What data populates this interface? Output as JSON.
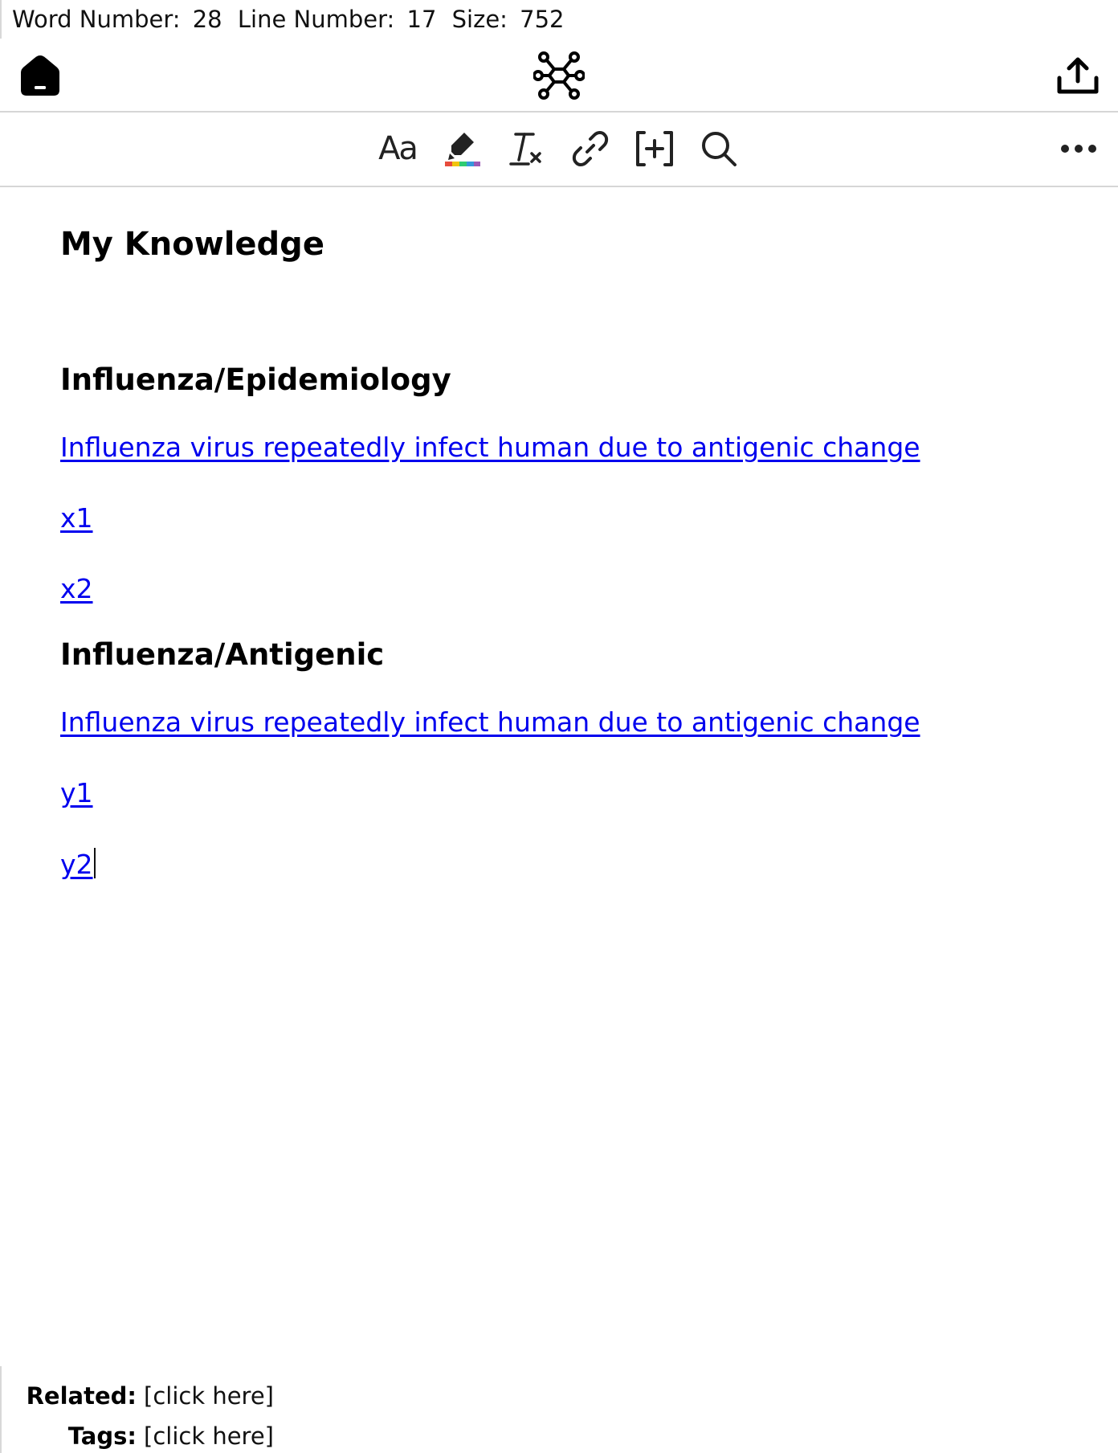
{
  "status": {
    "word_label": "Word Number:",
    "word_value": "28",
    "line_label": "Line Number:",
    "line_value": "17",
    "size_label": "Size:",
    "size_value": "752"
  },
  "icons": {
    "home": "home-icon",
    "graph": "graph-icon",
    "share": "share-icon",
    "font": "font-size-icon",
    "highlight": "highlighter-icon",
    "clear": "clear-format-icon",
    "link": "link-icon",
    "insert": "insert-bracket-icon",
    "search": "search-icon",
    "more": "more-icon"
  },
  "toolbar": {
    "font_glyph": "Aa",
    "highlight_colors": [
      "#e74c3c",
      "#f1c40f",
      "#2ecc71",
      "#3498db",
      "#9b59b6"
    ]
  },
  "document": {
    "title": "My Knowledge",
    "sections": [
      {
        "heading": "Influenza/Epidemiology",
        "links": [
          "Influenza virus repeatedly infect human due to antigenic change",
          "x1",
          "x2"
        ]
      },
      {
        "heading": "Influenza/Antigenic",
        "links": [
          "Influenza virus repeatedly infect human due to antigenic change",
          "y1",
          "y2"
        ]
      }
    ]
  },
  "footer": {
    "related_label": "Related:",
    "related_value": "[click here]",
    "tags_label": "Tags:",
    "tags_value": "[click here]"
  },
  "colors": {
    "link": "#0000ee",
    "divider": "#d6d6d6"
  }
}
